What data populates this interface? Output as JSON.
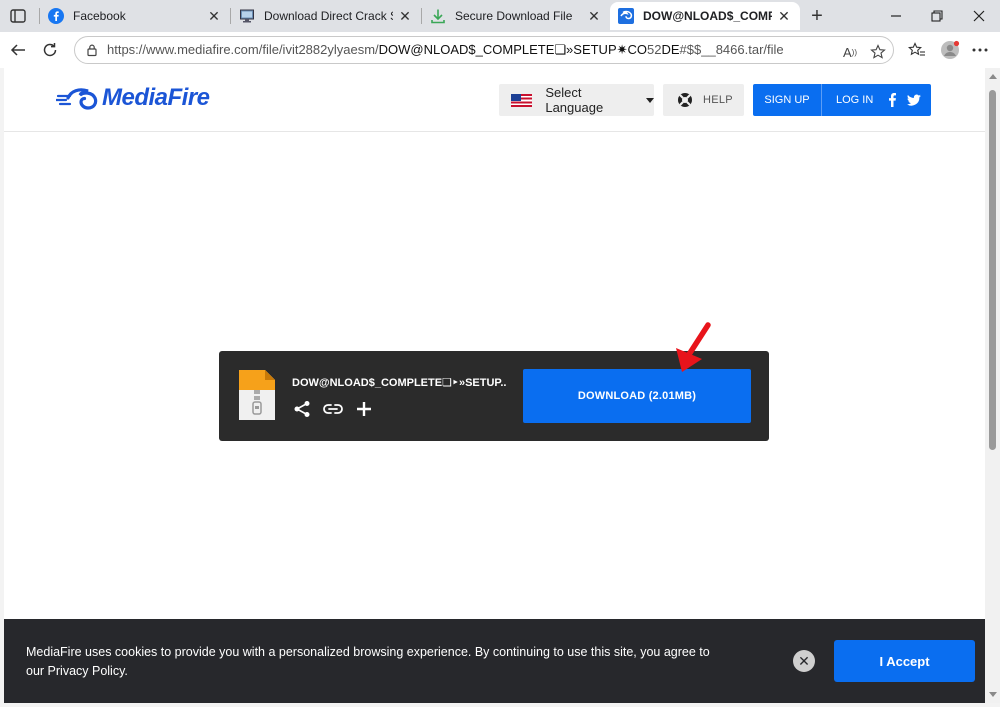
{
  "browser": {
    "tabs": [
      {
        "title": "Facebook",
        "icon": "facebook-icon",
        "active": false
      },
      {
        "title": "Download Direct Crack Setu",
        "icon": "monitor-icon",
        "active": false
      },
      {
        "title": "Secure Download File",
        "icon": "download-arrow-icon",
        "active": false
      },
      {
        "title": "DOW@NLOAD$_COMPLETE",
        "icon": "mediafire-icon",
        "active": true
      }
    ],
    "url_prefix": "https://www.mediafire.com/file/ivit2882ylyaesm/",
    "url_main": "DOW@NLOAD$_COMPLETE",
    "url_glyph": "❏",
    "url_mid": "»SETUP✷CO",
    "url_number": "52",
    "url_de": "DE",
    "url_suffix": "#$$__8466.tar/file"
  },
  "site": {
    "brand": "MediaFire",
    "brand_color": "#1b55d6",
    "language_label": "Select Language",
    "help_label": "HELP",
    "signup_label": "SIGN UP",
    "login_label": "LOG IN"
  },
  "file": {
    "name": "DOW@NLOAD$_COMPLETE❏‣»SETUP...",
    "download_label": "DOWNLOAD (2.01MB)"
  },
  "cookie": {
    "message": "MediaFire uses cookies to provide you with a personalized browsing experience. By continuing to use this site, you agree to our Privacy Policy.",
    "accept_label": "I Accept",
    "close_glyph": "✕"
  },
  "colors": {
    "accent": "#0a6ef0",
    "card_bg": "#2b2b2b",
    "banner_bg": "#27282c",
    "annotation_arrow": "#e8141b"
  }
}
